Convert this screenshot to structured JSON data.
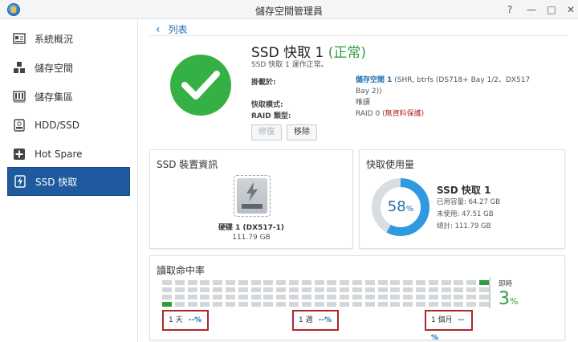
{
  "window": {
    "title": "儲存空間管理員",
    "help": "?",
    "minimize": "—",
    "maximize": "□",
    "close": "✕"
  },
  "sidebar": {
    "items": [
      {
        "label": "系統概況",
        "icon": "overview-icon",
        "active": false
      },
      {
        "label": "儲存空間",
        "icon": "storage-pool-icon",
        "active": false
      },
      {
        "label": "儲存集區",
        "icon": "storage-group-icon",
        "active": false
      },
      {
        "label": "HDD/SSD",
        "icon": "disk-icon",
        "active": false
      },
      {
        "label": "Hot Spare",
        "icon": "hot-spare-icon",
        "active": false
      },
      {
        "label": "SSD 快取",
        "icon": "ssd-cache-icon",
        "active": true
      }
    ]
  },
  "breadcrumb": {
    "back": "‹",
    "label": "列表"
  },
  "header": {
    "title": "SSD 快取 1",
    "status": "(正常)",
    "subtitle": "SSD 快取 1 運作正常。",
    "mounted_label": "掛載於:",
    "mounted_link": "儲存空間 1",
    "mounted_detail": " (SHR, btrfs (DS718+ Bay 1/2、DX517 Bay 2))",
    "mode_label": "快取模式:",
    "mode_value": "唯讀",
    "raid_label": "RAID 類型:",
    "raid_value": "RAID 0",
    "raid_note": "(無資料保護)",
    "repair_button": "修復",
    "remove_button": "移除"
  },
  "ssd_info": {
    "title": "SSD 裝置資訊",
    "drive_name": "硬碟 1 (DX517-1)",
    "drive_size": "111.79 GB"
  },
  "cache_usage": {
    "title": "快取使用量",
    "percent": "58",
    "percent_unit": "%",
    "percent_value": 58,
    "name": "SSD 快取 1",
    "used": "已用容量: 64.27 GB",
    "unused": "未使用: 47.51 GB",
    "total": "總計: 111.79 GB",
    "colors": {
      "used": "#2f9ae0",
      "free": "#d9dde0"
    }
  },
  "hit_rate": {
    "title": "讀取命中率",
    "current_label": "即時",
    "current_value": "3",
    "current_unit": "%",
    "periods": [
      {
        "label": "1 天",
        "value": "--%"
      },
      {
        "label": "1 週",
        "value": "--%"
      },
      {
        "label": "1 個月",
        "value": "--%"
      }
    ],
    "grid": {
      "columns": 26,
      "rows": 4,
      "on_cells": [
        [
          0,
          25
        ],
        [
          1,
          26
        ],
        [
          3,
          0
        ]
      ]
    }
  }
}
